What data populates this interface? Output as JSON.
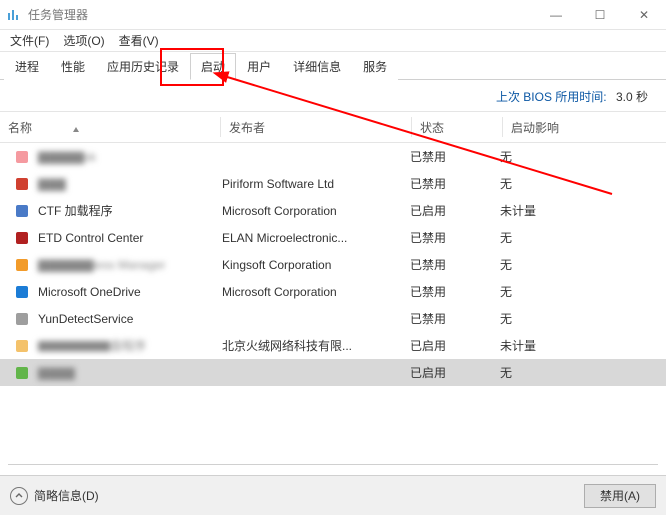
{
  "window": {
    "title": "任务管理器",
    "minimize_glyph": "—",
    "maximize_glyph": "☐",
    "close_glyph": "✕"
  },
  "menus": {
    "file": "文件(F)",
    "options": "选项(O)",
    "view": "查看(V)"
  },
  "tabs": {
    "processes": "进程",
    "performance": "性能",
    "app_history": "应用历史记录",
    "startup": "启动",
    "users": "用户",
    "details": "详细信息",
    "services": "服务"
  },
  "bios": {
    "label": "上次 BIOS 所用时间:",
    "value": "3.0 秒"
  },
  "columns": {
    "name": "名称",
    "publisher": "发布者",
    "status": "状态",
    "impact": "启动影响"
  },
  "rows": [
    {
      "name_redacted": "▇▇▇▇▇sk",
      "publisher": "",
      "status": "已禁用",
      "impact": "无",
      "icon_color": "#f59aa0"
    },
    {
      "name_redacted": "▇▇▇",
      "publisher": "Piriform Software Ltd",
      "status": "已禁用",
      "impact": "无",
      "icon_color": "#d04030"
    },
    {
      "name": "CTF 加载程序",
      "publisher": "Microsoft Corporation",
      "status": "已启用",
      "impact": "未计量",
      "icon_color": "#4a7ac7"
    },
    {
      "name": "ETD Control Center",
      "publisher": "ELAN Microelectronic...",
      "status": "已禁用",
      "impact": "无",
      "icon_color": "#b12020"
    },
    {
      "name_redacted": "▇▇▇▇▇▇iess Manager",
      "publisher": "Kingsoft Corporation",
      "status": "已禁用",
      "impact": "无",
      "icon_color": "#f29b2a"
    },
    {
      "name": "Microsoft OneDrive",
      "publisher": "Microsoft Corporation",
      "status": "已禁用",
      "impact": "无",
      "icon_color": "#1c7cd6"
    },
    {
      "name": "YunDetectService",
      "publisher": "",
      "status": "已禁用",
      "impact": "无",
      "icon_color": "#9e9e9e"
    },
    {
      "name_redacted": "▇▇▇▇▇▇盘程序",
      "publisher": "北京火绒网络科技有限...",
      "status": "已启用",
      "impact": "未计量",
      "icon_color": "#f4c26b"
    },
    {
      "name_redacted": "▇▇▇▇",
      "publisher": "",
      "status": "已启用",
      "impact": "无",
      "icon_color": "#62b54a",
      "selected": true
    }
  ],
  "footer": {
    "fewer_details": "简略信息(D)",
    "disable_button": "禁用(A)"
  }
}
